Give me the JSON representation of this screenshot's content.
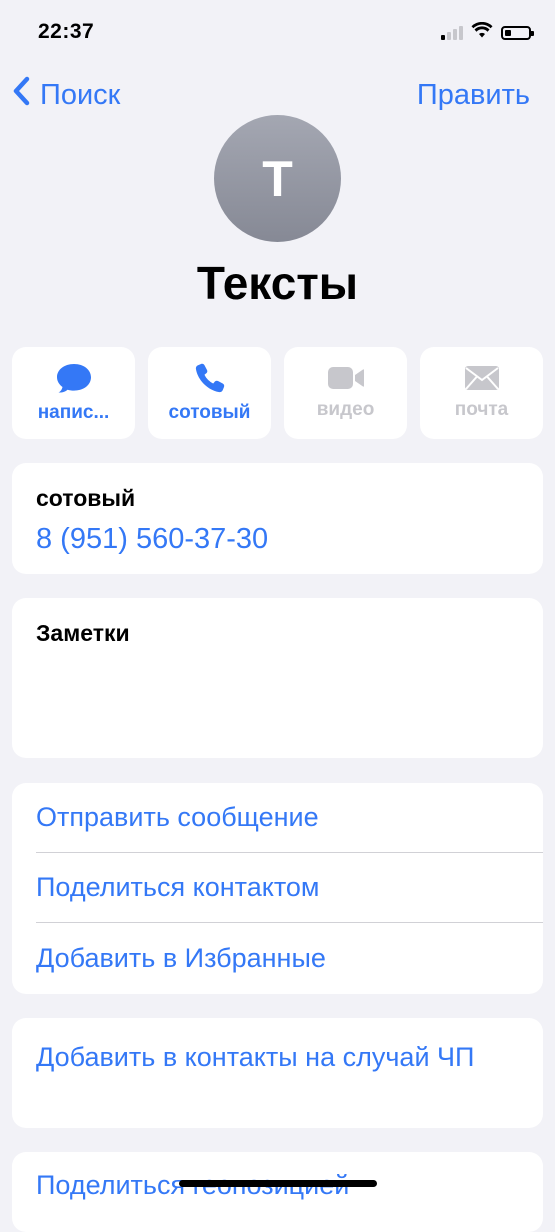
{
  "status_bar": {
    "time": "22:37",
    "signal_bars_active": 1,
    "signal_bars_total": 4,
    "battery_level": 0.25,
    "wifi_icon": "wifi-icon"
  },
  "nav": {
    "back_label": "Поиск",
    "back_icon": "chevron-left-icon",
    "edit_label": "Править"
  },
  "contact": {
    "avatar_initial": "T",
    "name": "Тексты"
  },
  "actions": [
    {
      "label": "напис...",
      "icon": "message-bubble-icon",
      "enabled": true
    },
    {
      "label": "сотовый",
      "icon": "phone-icon",
      "enabled": true
    },
    {
      "label": "видео",
      "icon": "video-camera-icon",
      "enabled": false
    },
    {
      "label": "почта",
      "icon": "envelope-icon",
      "enabled": false
    }
  ],
  "phone": {
    "label": "сотовый",
    "number": "8 (951) 560-37-30"
  },
  "notes": {
    "label": "Заметки"
  },
  "action_list": [
    "Отправить сообщение",
    "Поделиться контактом",
    "Добавить в Избранные"
  ],
  "emergency": {
    "label": "Добавить в контакты на случай ЧП"
  },
  "location": {
    "label": "Поделиться геопозицией"
  },
  "colors": {
    "accent": "#3478f6",
    "background": "#f2f2f7",
    "disabled": "#c7c7cc"
  }
}
